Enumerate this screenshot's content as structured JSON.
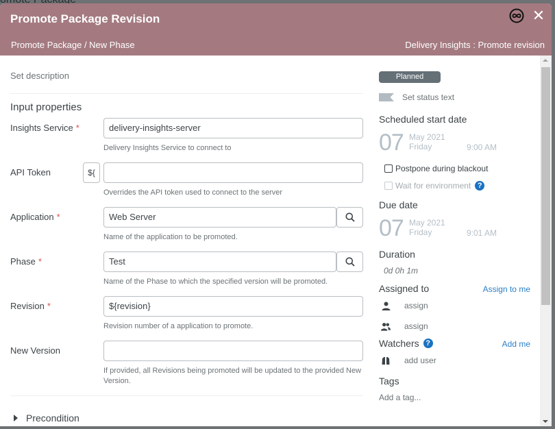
{
  "background": {
    "page_title_fragment": "omote Package"
  },
  "header": {
    "title": "Promote Package Revision",
    "breadcrumb": "Promote Package / New Phase",
    "subtitle": "Delivery Insights : Promote revision",
    "icons": {
      "infinity": "infinity-icon",
      "close": "close-icon"
    },
    "close_glyph": "✕",
    "color": "#a47a80"
  },
  "left": {
    "description_placeholder": "Set description",
    "section_title": "Input properties",
    "fields": [
      {
        "label": "Insights Service",
        "required": true,
        "value": "delivery-insights-server",
        "help": "Delivery Insights Service to connect to"
      },
      {
        "label": "API Token",
        "required": false,
        "value": "",
        "variable_button": "${",
        "help": "Overrides the API token used to connect to the server"
      },
      {
        "label": "Application",
        "required": true,
        "value": "Web Server",
        "has_search": true,
        "help": "Name of the application to be promoted."
      },
      {
        "label": "Phase",
        "required": true,
        "value": "Test",
        "has_search": true,
        "help": "Name of the Phase to which the specified version will be promoted."
      },
      {
        "label": "Revision",
        "required": true,
        "value": "${revision}",
        "help": "Revision number of a application to promote."
      },
      {
        "label": "New Version",
        "required": false,
        "value": "",
        "help": "If provided, all Revisions being promoted will be updated to the provided New Version."
      }
    ],
    "required_marker": "*",
    "precondition_label": "Precondition"
  },
  "right": {
    "status": "Planned",
    "status_color": "#646f76",
    "status_text_placeholder": "Set status text",
    "scheduled_start": {
      "heading": "Scheduled start date",
      "day": "07",
      "month_year": "May 2021",
      "weekday": "Friday",
      "time": "9:00 AM"
    },
    "postpone_blackout": {
      "label": "Postpone during blackout",
      "checked": false
    },
    "wait_for_environment": {
      "label": "Wait for environment",
      "checked": false,
      "disabled": true
    },
    "help_glyph": "?",
    "due_date": {
      "heading": "Due date",
      "day": "07",
      "month_year": "May 2021",
      "weekday": "Friday",
      "time": "9:01 AM"
    },
    "duration": {
      "heading": "Duration",
      "value": "0d 0h 1m"
    },
    "assigned_to": {
      "heading": "Assigned to",
      "assign_to_me": "Assign to me",
      "user_placeholder": "assign",
      "team_placeholder": "assign"
    },
    "watchers": {
      "heading": "Watchers",
      "add_me": "Add me",
      "add_user": "add user"
    },
    "tags": {
      "heading": "Tags",
      "placeholder": "Add a tag..."
    }
  }
}
